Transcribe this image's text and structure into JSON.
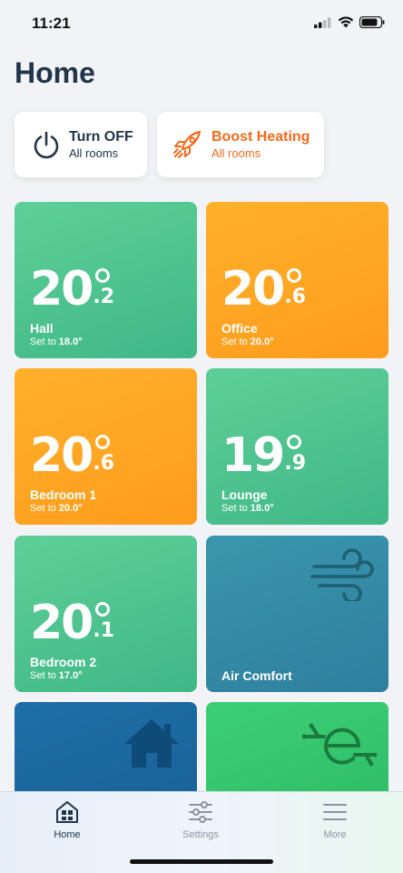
{
  "status": {
    "time": "11:21"
  },
  "page": {
    "title": "Home"
  },
  "quick_actions": [
    {
      "title": "Turn OFF",
      "subtitle": "All rooms",
      "icon": "power-icon"
    },
    {
      "title": "Boost Heating",
      "subtitle": "All rooms",
      "icon": "rocket-icon"
    }
  ],
  "rooms": [
    {
      "name": "Hall",
      "temp_int": "20",
      "temp_dec": ".2",
      "set_prefix": "Set to ",
      "set_value": "18.0°",
      "color": "#4fc28e"
    },
    {
      "name": "Office",
      "temp_int": "20",
      "temp_dec": ".6",
      "set_prefix": "Set to ",
      "set_value": "20.0°",
      "color": "#ffa624"
    },
    {
      "name": "Bedroom 1",
      "temp_int": "20",
      "temp_dec": ".6",
      "set_prefix": "Set to ",
      "set_value": "20.0°",
      "color": "#ffa624"
    },
    {
      "name": "Lounge",
      "temp_int": "19",
      "temp_dec": ".9",
      "set_prefix": "Set to ",
      "set_value": "18.0°",
      "color": "#4fc28e"
    },
    {
      "name": "Bedroom 2",
      "temp_int": "20",
      "temp_dec": ".1",
      "set_prefix": "Set to ",
      "set_value": "17.0°",
      "color": "#4fc28e"
    }
  ],
  "feature_tiles": [
    {
      "label": "Air Comfort",
      "icon": "wind-icon",
      "color": "#338aa5"
    },
    {
      "label": "",
      "icon": "house-icon",
      "color": "#1b67a0"
    },
    {
      "label": "",
      "icon": "energy-e-icon",
      "color": "#33c46c"
    }
  ],
  "tabs": [
    {
      "label": "Home",
      "icon": "home-grid-icon",
      "active": true
    },
    {
      "label": "Settings",
      "icon": "sliders-icon",
      "active": false
    },
    {
      "label": "More",
      "icon": "menu-icon",
      "active": false
    }
  ]
}
